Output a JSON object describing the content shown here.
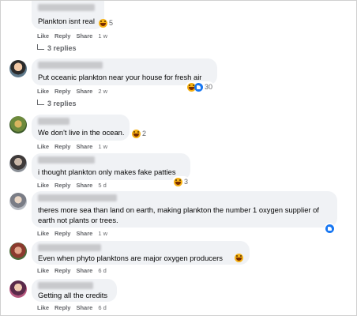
{
  "actions": {
    "like": "Like",
    "reply": "Reply",
    "share": "Share"
  },
  "comments": [
    {
      "text": "Plankton isnt real",
      "time": "1 w",
      "reactions": "5",
      "replies": "3 replies"
    },
    {
      "text": "Put oceanic plankton near your house for fresh air",
      "time": "2 w",
      "reactions": "30",
      "replies": "3 replies"
    },
    {
      "text": "We don't live in the ocean.",
      "time": "1 w",
      "reactions": "2"
    },
    {
      "text": "i thought plankton only makes fake patties",
      "time": "5 d",
      "reactions": "3"
    },
    {
      "text": "theres more sea than land on earth, making plankton the number 1 oxygen supplier of earth not plants or trees.",
      "time": "1 w"
    },
    {
      "text": "Even when phyto planktons are major oxygen producers",
      "time": "6 d"
    },
    {
      "text": "Getting all the credits",
      "time": "6 d"
    }
  ],
  "colors": {
    "bubble": "#f0f2f5",
    "meta": "#65676b",
    "like_blue": "#1877f2",
    "haha_yellow": "#f5b014"
  },
  "icons": [
    "haha-emoji-icon",
    "like-emoji-icon",
    "reply-arrow-icon"
  ]
}
